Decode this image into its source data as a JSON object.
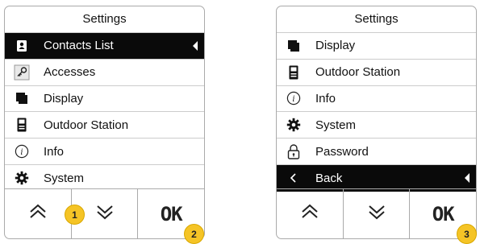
{
  "panel_left": {
    "title": "Settings",
    "items": [
      {
        "label": "Contacts List",
        "icon": "contacts-book-icon",
        "selected": true
      },
      {
        "label": "Accesses",
        "icon": "key-icon"
      },
      {
        "label": "Display",
        "icon": "display-icon"
      },
      {
        "label": "Outdoor Station",
        "icon": "outdoor-station-icon"
      },
      {
        "label": "Info",
        "icon": "info-icon"
      },
      {
        "label": "System",
        "icon": "gear-icon"
      }
    ],
    "ok_label": "OK"
  },
  "panel_right": {
    "title": "Settings",
    "items": [
      {
        "label": "Display",
        "icon": "display-icon"
      },
      {
        "label": "Outdoor Station",
        "icon": "outdoor-station-icon"
      },
      {
        "label": "Info",
        "icon": "info-icon"
      },
      {
        "label": "System",
        "icon": "gear-icon"
      },
      {
        "label": "Password",
        "icon": "padlock-icon"
      },
      {
        "label": "Back",
        "icon": "back-arrow-icon",
        "selected": true
      }
    ],
    "ok_label": "OK"
  },
  "annotations": {
    "badge_1": "1",
    "badge_2": "2",
    "badge_3": "3"
  },
  "colors": {
    "selected_background": "#0a0a0a",
    "badge_fill": "#f5c426",
    "border": "#aaaaaa"
  }
}
